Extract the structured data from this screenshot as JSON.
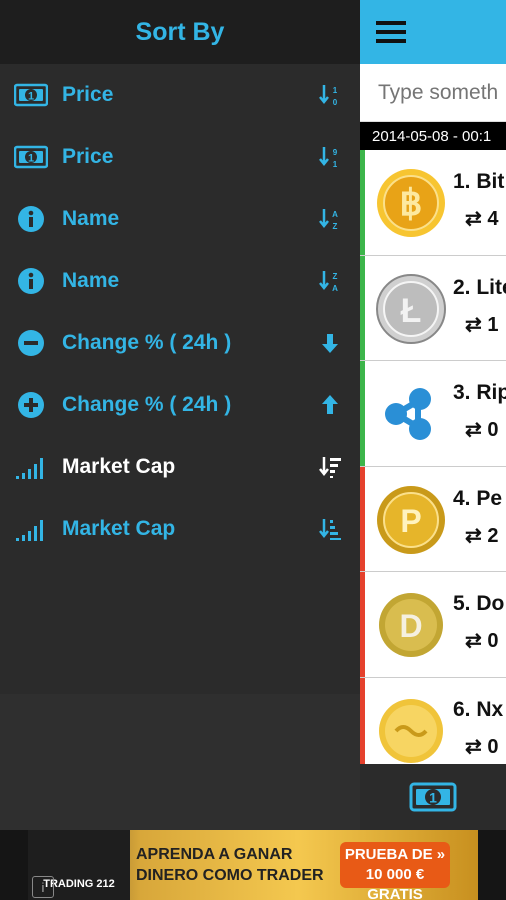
{
  "drawer": {
    "title": "Sort By",
    "items": [
      {
        "label": "Price",
        "icon": "money-icon",
        "sort_icon": "sort-numeric-asc-icon"
      },
      {
        "label": "Price",
        "icon": "money-icon",
        "sort_icon": "sort-numeric-desc-icon"
      },
      {
        "label": "Name",
        "icon": "info-icon",
        "sort_icon": "sort-alpha-asc-icon"
      },
      {
        "label": "Name",
        "icon": "info-icon",
        "sort_icon": "sort-alpha-desc-icon"
      },
      {
        "label": "Change % ( 24h )",
        "icon": "minus-circle-icon",
        "sort_icon": "arrow-down-icon"
      },
      {
        "label": "Change % ( 24h )",
        "icon": "plus-circle-icon",
        "sort_icon": "arrow-up-icon"
      },
      {
        "label": "Market Cap",
        "icon": "signal-bars-icon",
        "sort_icon": "sort-amount-desc-icon",
        "active": true
      },
      {
        "label": "Market Cap",
        "icon": "signal-bars-icon",
        "sort_icon": "sort-amount-asc-icon"
      }
    ]
  },
  "main": {
    "search_placeholder": "Type someth",
    "date": "2014-05-08 - 00:1",
    "coins": [
      {
        "name": "1. Bit",
        "vol": "⇄ 4",
        "trend": "up"
      },
      {
        "name": "2. Lite",
        "vol": "⇄ 1",
        "trend": "up"
      },
      {
        "name": "3. Rip",
        "vol": "⇄ 0",
        "trend": "up"
      },
      {
        "name": "4. Pe",
        "vol": "⇄ 2",
        "trend": "down"
      },
      {
        "name": "5. Do",
        "vol": "⇄ 0",
        "trend": "down"
      },
      {
        "name": "6. Nx",
        "vol": "⇄ 0",
        "trend": "down"
      }
    ]
  },
  "ad": {
    "brand": "TRADING 212",
    "line1": "APRENDA A GANAR",
    "line2": "DINERO COMO TRADER",
    "cta1": "PRUEBA DE »",
    "cta2": "10 000 € GRATIS",
    "info": "i"
  },
  "colors": {
    "accent": "#33b5e5",
    "up": "#3cb54a",
    "down": "#e5412d"
  }
}
